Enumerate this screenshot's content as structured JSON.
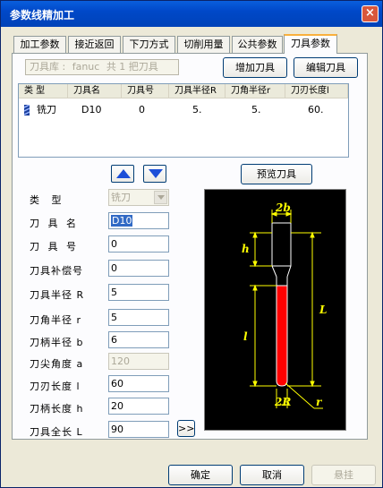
{
  "window": {
    "title": "参数线精加工",
    "close_icon": "×"
  },
  "tabs": [
    {
      "label": "加工参数"
    },
    {
      "label": "接近返回"
    },
    {
      "label": "下刀方式"
    },
    {
      "label": "切削用量"
    },
    {
      "label": "公共参数"
    },
    {
      "label": "刀具参数",
      "active": true
    }
  ],
  "toolbox": {
    "library_label": "刀具库 :",
    "library_name": "fanuc",
    "count_text": "共 1 把刀具",
    "add_button": "增加刀具",
    "edit_button": "编辑刀具"
  },
  "tool_list": {
    "columns": [
      "类 型",
      "刀具名",
      "刀具号",
      "刀具半径R",
      "刀角半径r",
      "刀刃长度l"
    ],
    "rows": [
      {
        "type": "铣刀",
        "name": "D10",
        "number": "0",
        "radius": "5.",
        "corner_radius": "5.",
        "blade_length": "60."
      }
    ]
  },
  "preview_button": "预览刀具",
  "form": {
    "type": {
      "label": "类    型",
      "value": "铣刀"
    },
    "name": {
      "label": "刀 具 名",
      "value": "D10"
    },
    "number": {
      "label": "刀 具 号",
      "value": "0"
    },
    "comp_number": {
      "label": "刀具补偿号",
      "value": "0"
    },
    "radius": {
      "label": "刀具半径 R",
      "value": "5"
    },
    "corner_radius": {
      "label": "刀角半径 r",
      "value": "5"
    },
    "shank_radius": {
      "label": "刀柄半径 b",
      "value": "6"
    },
    "tip_angle": {
      "label": "刀尖角度 a",
      "value": "120"
    },
    "blade_length": {
      "label": "刀刃长度 l",
      "value": "60"
    },
    "shank_length": {
      "label": "刀柄长度 h",
      "value": "20"
    },
    "total_length": {
      "label": "刀具全长 L",
      "value": "90"
    },
    "expand_button": ">>"
  },
  "diagram": {
    "label_2b": "2b",
    "label_h": "h",
    "label_L": "L",
    "label_l": "l",
    "label_2R": "2R",
    "label_r": "r"
  },
  "footer": {
    "ok": "确定",
    "cancel": "取消",
    "hang": "悬挂"
  },
  "colors": {
    "title_bar": "#0048c8",
    "tab_accent": "#f9b03d",
    "blade": "#ff0000",
    "dimension": "#ffff00"
  }
}
